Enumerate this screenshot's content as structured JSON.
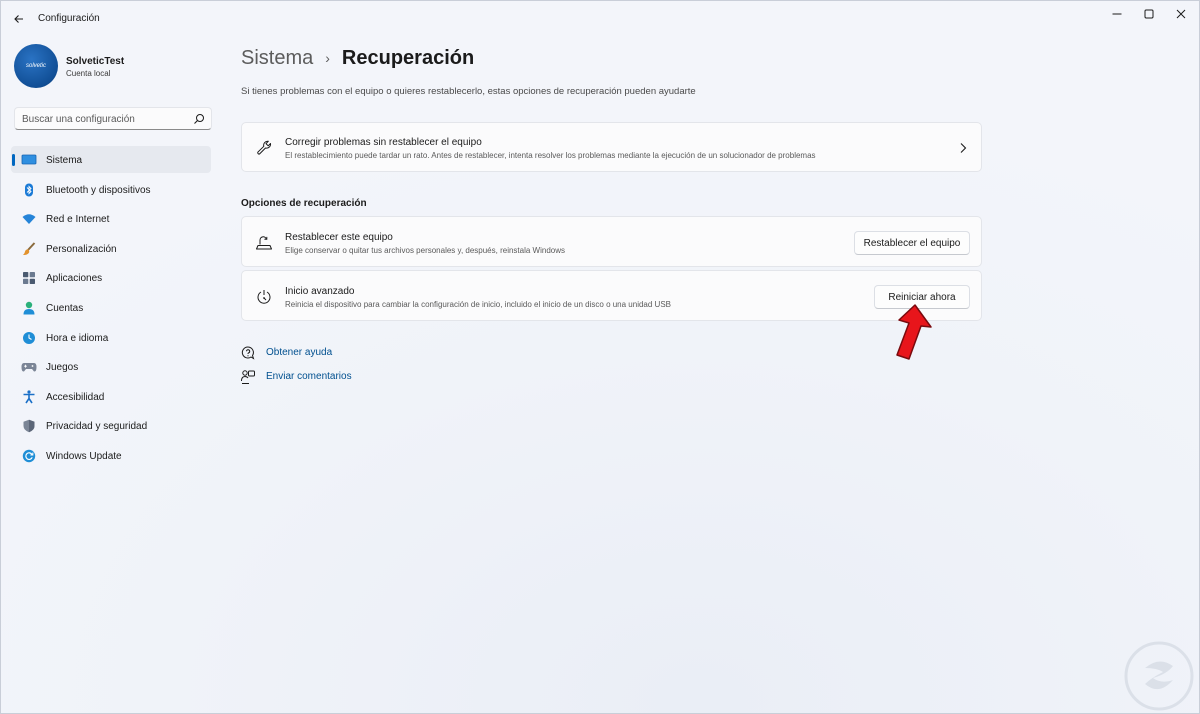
{
  "window": {
    "title": "Configuración",
    "controls": [
      "minimize",
      "maximize",
      "close"
    ]
  },
  "profile": {
    "avatar_text": "solvetic",
    "name": "SolveticTest",
    "account_type": "Cuenta local"
  },
  "search": {
    "placeholder": "Buscar una configuración"
  },
  "sidebar": {
    "items": [
      {
        "label": "Sistema",
        "icon": "system-icon",
        "active": true
      },
      {
        "label": "Bluetooth y dispositivos",
        "icon": "bluetooth-icon"
      },
      {
        "label": "Red e Internet",
        "icon": "wifi-icon"
      },
      {
        "label": "Personalización",
        "icon": "brush-icon"
      },
      {
        "label": "Aplicaciones",
        "icon": "apps-icon"
      },
      {
        "label": "Cuentas",
        "icon": "accounts-icon"
      },
      {
        "label": "Hora e idioma",
        "icon": "time-language-icon"
      },
      {
        "label": "Juegos",
        "icon": "gamepad-icon"
      },
      {
        "label": "Accesibilidad",
        "icon": "accessibility-icon"
      },
      {
        "label": "Privacidad y seguridad",
        "icon": "shield-icon"
      },
      {
        "label": "Windows Update",
        "icon": "windows-update-icon"
      }
    ]
  },
  "main": {
    "breadcrumb_parent": "Sistema",
    "breadcrumb_current": "Recuperación",
    "intro": "Si tienes problemas con el equipo o quieres restablecerlo, estas opciones de recuperación pueden ayudarte",
    "fix_card": {
      "title": "Corregir problemas sin restablecer el equipo",
      "description": "El restablecimiento puede tardar un rato. Antes de restablecer, intenta resolver los problemas mediante la ejecución de un solucionador de problemas"
    },
    "section_title": "Opciones de recuperación",
    "reset_card": {
      "title": "Restablecer este equipo",
      "description": "Elige conservar o quitar tus archivos personales y, después, reinstala Windows",
      "button": "Restablecer el equipo"
    },
    "advanced_card": {
      "title": "Inicio avanzado",
      "description": "Reinicia el dispositivo para cambiar la configuración de inicio, incluido el inicio de un disco o una unidad USB",
      "button": "Reiniciar ahora"
    },
    "links": {
      "help": "Obtener ayuda",
      "feedback": "Enviar comentarios"
    }
  },
  "colors": {
    "accent": "#0067c0",
    "link": "#00508f",
    "annotation_arrow": "#e8151b"
  }
}
